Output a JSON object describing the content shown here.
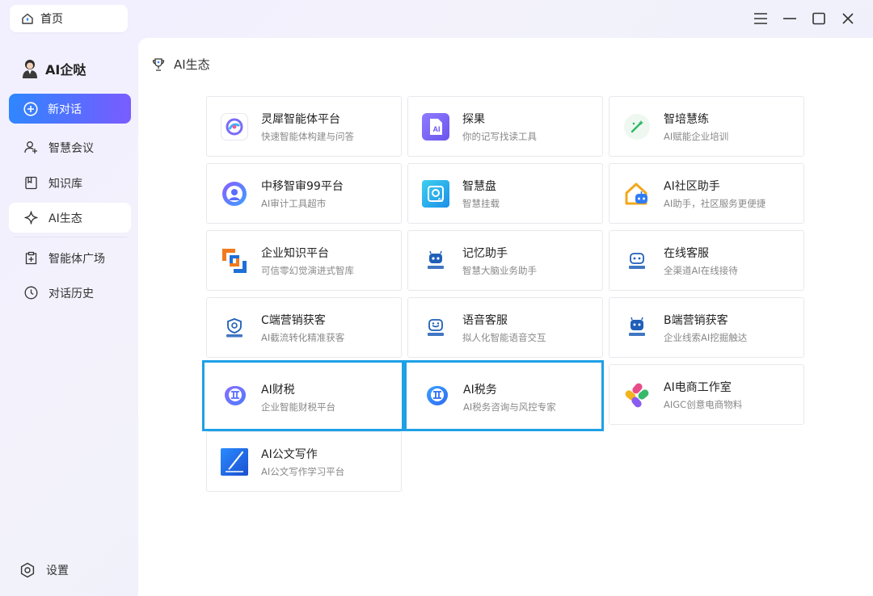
{
  "window": {
    "tab_label": "首页"
  },
  "sidebar": {
    "brand": "AI企哒",
    "new_chat": "新对话",
    "items": [
      {
        "label": "智慧会议",
        "icon": "user-add-icon"
      },
      {
        "label": "知识库",
        "icon": "book-icon"
      },
      {
        "label": "AI生态",
        "icon": "sparkle-icon",
        "active": true
      },
      {
        "label": "智能体广场",
        "icon": "square-plus-icon"
      },
      {
        "label": "对话历史",
        "icon": "clock-icon"
      }
    ],
    "settings": "设置"
  },
  "main": {
    "title": "AI生态",
    "cards": [
      {
        "title": "灵犀智能体平台",
        "subtitle": "快速智能体构建与问答",
        "icon": "lingxi-logo-icon"
      },
      {
        "title": "探果",
        "subtitle": "你的记写找读工具",
        "icon": "tanguo-logo-icon"
      },
      {
        "title": "智培慧练",
        "subtitle": "AI赋能企业培训",
        "icon": "wand-logo-icon"
      },
      {
        "title": "中移智审99平台",
        "subtitle": "AI审计工具超市",
        "icon": "audit-logo-icon"
      },
      {
        "title": "智慧盘",
        "subtitle": "智慧挂载",
        "icon": "disk-logo-icon"
      },
      {
        "title": "AI社区助手",
        "subtitle": "AI助手，社区服务更便捷",
        "icon": "house-bot-icon"
      },
      {
        "title": "企业知识平台",
        "subtitle": "可信零幻觉演进式智库",
        "icon": "knowledge-logo-icon"
      },
      {
        "title": "记忆助手",
        "subtitle": "智慧大脑业务助手",
        "icon": "memory-bot-icon"
      },
      {
        "title": "在线客服",
        "subtitle": "全渠道AI在线接待",
        "icon": "service-bot-icon"
      },
      {
        "title": "C端营销获客",
        "subtitle": "AI截流转化精准获客",
        "icon": "c-marketing-icon"
      },
      {
        "title": "语音客服",
        "subtitle": "拟人化智能语音交互",
        "icon": "voice-bot-icon"
      },
      {
        "title": "B端营销获客",
        "subtitle": "企业线索AI挖掘触达",
        "icon": "b-marketing-icon"
      },
      {
        "title": "AI财税",
        "subtitle": "企业智能财税平台",
        "icon": "tax-logo-icon",
        "selected": true
      },
      {
        "title": "AI税务",
        "subtitle": "AI税务咨询与风控专家",
        "icon": "tax-logo-icon",
        "selected": true
      },
      {
        "title": "AI电商工作室",
        "subtitle": "AIGC创意电商物料",
        "icon": "ecommerce-logo-icon"
      },
      {
        "title": "AI公文写作",
        "subtitle": "AI公文写作学习平台",
        "icon": "writing-logo-icon"
      }
    ]
  },
  "colors": {
    "accent_gradient_start": "#2f86ff",
    "accent_gradient_end": "#7a5cff",
    "selection_border": "#1ea0e6"
  }
}
